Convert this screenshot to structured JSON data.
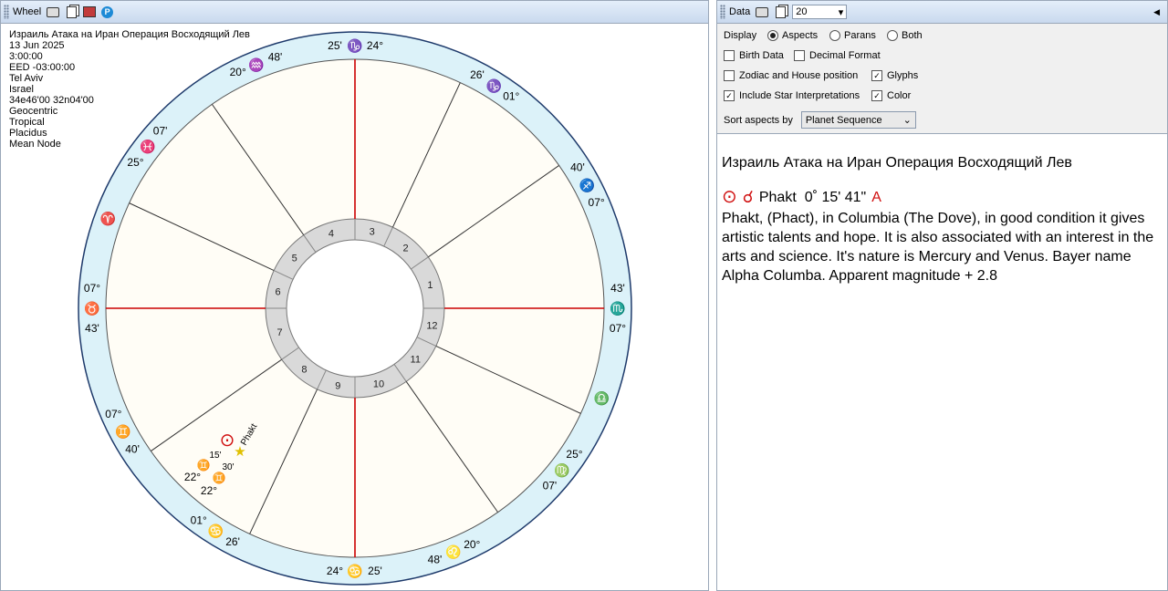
{
  "wheel_panel": {
    "title": "Wheel",
    "icons": [
      "print-icon",
      "copy-icon",
      "save-image-icon",
      "p-icon"
    ]
  },
  "chart_info": [
    "Израиль Атака на Иран Операция Восходящий Лев",
    "13 Jun 2025",
    "3:00:00",
    "EED -03:00:00",
    "Tel Aviv",
    "Israel",
    "34e46'00 32n04'00",
    "Geocentric",
    "Tropical",
    "Placidus",
    "Mean Node"
  ],
  "wheel": {
    "colors": {
      "ring": "#dcf2f9",
      "axis": "#cc0000",
      "house_ring": "#d9d9d9"
    },
    "house_numbers": [
      "1",
      "2",
      "3",
      "4",
      "5",
      "6",
      "7",
      "8",
      "9",
      "10",
      "11",
      "12"
    ],
    "cusps": [
      {
        "deg": "24°",
        "sign": "♑",
        "min": "25'"
      },
      {
        "deg": "01°",
        "sign": "♑",
        "min": "26'"
      },
      {
        "deg": "07°",
        "sign": "♐",
        "min": "40'"
      },
      {
        "deg": "07°",
        "sign": "♏",
        "min": "43'"
      },
      {
        "deg": "07'",
        "sign": "♍",
        "min": "25°"
      },
      {
        "deg": "48'",
        "sign": "♌",
        "min": "20°"
      },
      {
        "deg": "24°",
        "sign": "♋",
        "min": "25'"
      },
      {
        "deg": "01°",
        "sign": "♋",
        "min": "26'"
      },
      {
        "deg": "07°",
        "sign": "♊",
        "min": "40'"
      },
      {
        "deg": "07°",
        "sign": "♉",
        "min": "43'"
      },
      {
        "deg": "07'",
        "sign": "♓",
        "min": "25°"
      },
      {
        "deg": "48'",
        "sign": "♒",
        "min": "20°"
      }
    ],
    "intercepted": [
      {
        "sign": "♈"
      },
      {
        "sign": "♎"
      }
    ],
    "planets": {
      "sun_glyph": "⊙",
      "star_glyph": "★",
      "star_name": "Phakt",
      "sun_min": "15'",
      "sun_sign": "♊",
      "sun_deg": "22°",
      "star_min": "30'",
      "star_sign": "♊",
      "star_deg": "22°"
    }
  },
  "data_panel": {
    "title": "Data",
    "count": "20",
    "display_label": "Display",
    "display_options": [
      "Aspects",
      "Parans",
      "Both"
    ],
    "display_selected": "Aspects",
    "checkboxes": {
      "birth_data": {
        "label": "Birth Data",
        "checked": false
      },
      "decimal_format": {
        "label": "Decimal Format",
        "checked": false
      },
      "zodiac_house": {
        "label": "Zodiac and House position",
        "checked": false
      },
      "glyphs": {
        "label": "Glyphs",
        "checked": true
      },
      "star_interp": {
        "label": "Include Star Interpretations",
        "checked": true
      },
      "color": {
        "label": "Color",
        "checked": true
      }
    },
    "sort_label": "Sort aspects by",
    "sort_value": "Planet Sequence"
  },
  "report": {
    "title": "Израиль Атака на Иран Операция Восходящий Лев",
    "sun_glyph": "⊙",
    "aspect_glyph": "☌",
    "star": "Phakt",
    "orb": "0˚ 15' 41\"",
    "applying": "A",
    "interpretation": "Phakt, (Phact), in Columbia (The Dove), in good condition it gives artistic talents and hope. It is also associated with an interest in the arts and science. It's nature is Mercury and Venus. Bayer name Alpha Columba. Apparent magnitude + 2.8"
  }
}
